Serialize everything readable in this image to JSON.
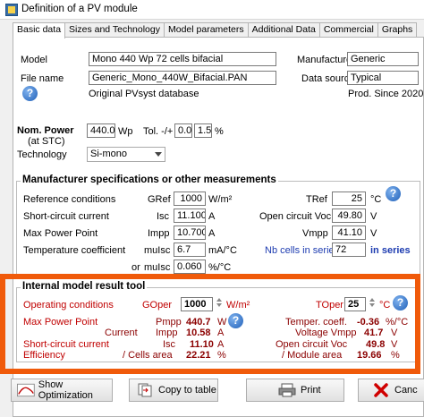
{
  "window": {
    "title": "Definition of a PV module"
  },
  "tabs": [
    "Basic data",
    "Sizes and Technology",
    "Model parameters",
    "Additional Data",
    "Commercial",
    "Graphs"
  ],
  "header": {
    "model_label": "Model",
    "model_value": "Mono 440 Wp 72 cells bifacial",
    "manufacturer_label": "Manufacturer",
    "manufacturer_value": "Generic",
    "filename_label": "File name",
    "filename_value": "Generic_Mono_440W_Bifacial.PAN",
    "datasource_label": "Data source",
    "datasource_value": "Typical",
    "database_note": "Original PVsyst database",
    "prod_note": "Prod. Since 2020"
  },
  "power": {
    "nom_label": "Nom. Power",
    "stc_label": "(at STC)",
    "nom_value": "440.0",
    "unit": "Wp",
    "tol_label": "Tol. -/+",
    "tol_minus": "0.0",
    "tol_plus": "1.5",
    "tol_unit": "%",
    "tech_label": "Technology",
    "tech_value": "Si-mono"
  },
  "manufacturer_specs": {
    "title": "Manufacturer specifications or other measurements",
    "ref_label": "Reference conditions",
    "gref_label": "GRef",
    "gref_value": "1000",
    "gref_unit": "W/m²",
    "tref_label": "TRef",
    "tref_value": "25",
    "tref_unit": "°C",
    "isc_label": "Short-circuit current",
    "isc_sym": "Isc",
    "isc_value": "11.100",
    "isc_unit": "A",
    "voc_label": "Open circuit Voc",
    "voc_value": "49.80",
    "voc_unit": "V",
    "mpp_label": "Max Power Point",
    "impp_sym": "Impp",
    "impp_value": "10.700",
    "impp_unit": "A",
    "vmpp_label": "Vmpp",
    "vmpp_value": "41.10",
    "vmpp_unit": "V",
    "tc_label": "Temperature coefficient",
    "muisc_sym": "muIsc",
    "muisc_value": "6.7",
    "muisc_unit": "mA/°C",
    "cells_label": "Nb cells in series",
    "cells_value": "72",
    "cells_suffix": "in series",
    "or_label": "or",
    "muisc2_sym": "muIsc",
    "muisc2_value": "0.060",
    "muisc2_unit": "%/°C"
  },
  "internal_model": {
    "title": "Internal model result tool",
    "op_label": "Operating conditions",
    "goper_label": "GOper",
    "goper_value": "1000",
    "goper_unit": "W/m²",
    "toper_label": "TOper",
    "toper_value": "25",
    "toper_unit": "°C",
    "mpp_label": "Max Power Point",
    "pmpp_sym": "Pmpp",
    "pmpp_value": "440.7",
    "pmpp_unit": "W",
    "tempcoeff_label": "Temper. coeff.",
    "tempcoeff_value": "-0.36",
    "tempcoeff_unit": "%/°C",
    "current_label": "Current",
    "impp_sym": "Impp",
    "impp_value": "10.58",
    "impp_unit": "A",
    "voltage_label": "Voltage Vmpp",
    "vmpp_value": "41.7",
    "vmpp_unit": "V",
    "isc_label": "Short-circuit current",
    "isc_sym": "Isc",
    "isc_value": "11.10",
    "isc_unit": "A",
    "voc_label": "Open circuit Voc",
    "voc_value": "49.8",
    "voc_unit": "V",
    "eff_label": "Efficiency",
    "cells_area_label": "/ Cells area",
    "cells_area_value": "22.21",
    "cells_area_unit": "%",
    "module_area_label": "/ Module area",
    "module_area_value": "19.66",
    "module_area_unit": "%"
  },
  "buttons": {
    "show_optimization": "Show Optimization",
    "copy_to_table": "Copy to table",
    "print": "Print",
    "cancel": "Canc"
  },
  "icons": {
    "help": "?"
  },
  "colors": {
    "highlight": "#f05a0a",
    "label_blue": "#1c3bb0",
    "result_red": "#c00000"
  }
}
